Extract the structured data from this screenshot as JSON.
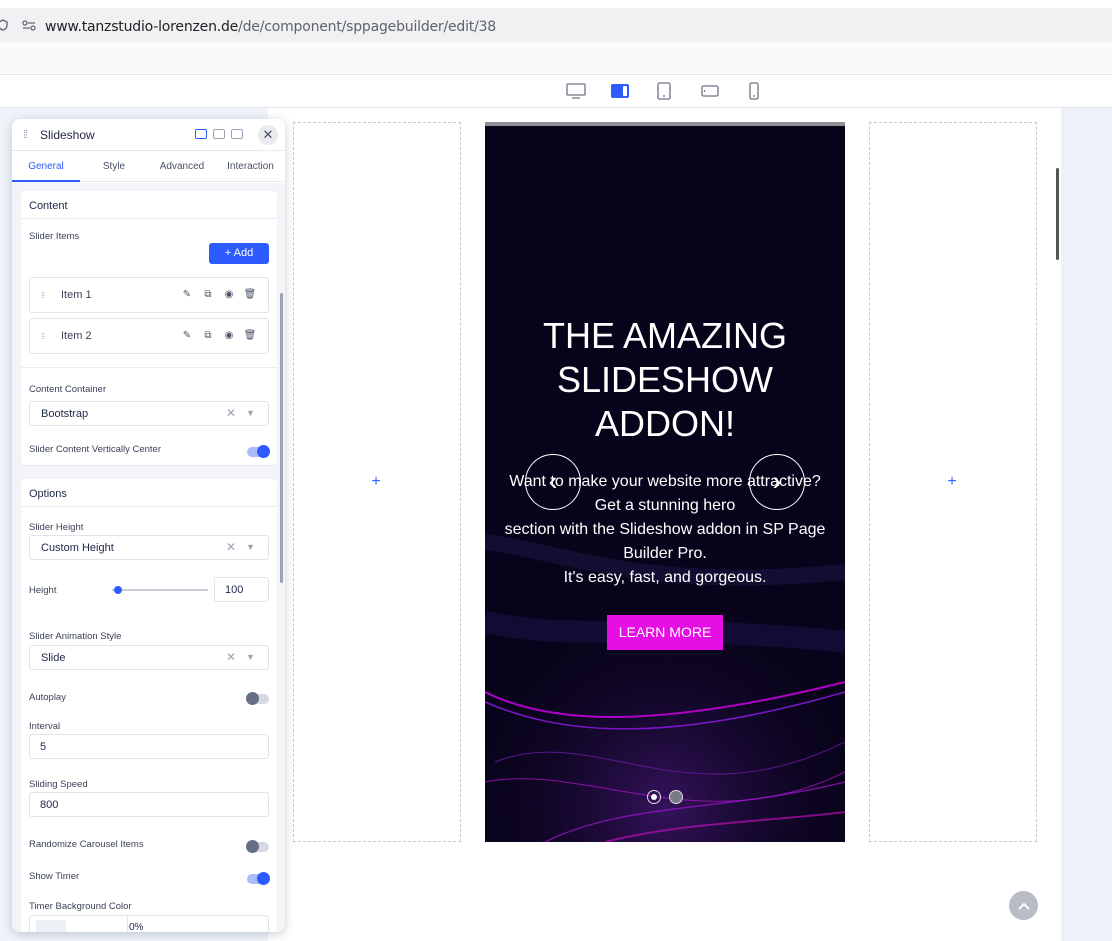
{
  "browser": {
    "url_domain": "www.tanzstudio-lorenzen.de",
    "url_path": "/de/component/sppagebuilder/edit/38"
  },
  "devices": [
    "desktop-icon",
    "laptop-icon",
    "tablet-icon",
    "tablet-landscape-icon",
    "mobile-icon"
  ],
  "panel": {
    "title": "Slideshow",
    "tabs": [
      "General",
      "Style",
      "Advanced",
      "Interaction"
    ],
    "content": {
      "section_title": "Content",
      "slider_items_label": "Slider Items",
      "add_label": "+ Add",
      "items": [
        "Item 1",
        "Item 2"
      ],
      "content_container_label": "Content Container",
      "content_container_value": "Bootstrap",
      "vertically_center_label": "Slider Content Vertically Center",
      "vertically_center_on": true
    },
    "options": {
      "section_title": "Options",
      "slider_height_label": "Slider Height",
      "slider_height_value": "Custom Height",
      "height_label": "Height",
      "height_value": "100",
      "height_slider_fraction": 0.05,
      "animation_label": "Slider Animation Style",
      "animation_value": "Slide",
      "autoplay_label": "Autoplay",
      "autoplay_on": false,
      "interval_label": "Interval",
      "interval_value": "5",
      "speed_label": "Sliding Speed",
      "speed_value": "800",
      "randomize_label": "Randomize Carousel Items",
      "randomize_on": false,
      "show_timer_label": "Show Timer",
      "show_timer_on": true,
      "timer_bg_label": "Timer Background Color",
      "timer_bg_value": "0%"
    }
  },
  "slide": {
    "title_line1": "THE AMAZING",
    "title_line2": "SLIDESHOW",
    "title_line3": "ADDON!",
    "sub_line1": "Want to make your website more attractive?",
    "sub_line2": "Get a stunning hero",
    "sub_line3": "section with the Slideshow addon in SP Page",
    "sub_line4": "Builder Pro.",
    "sub_line5": "It's easy, fast, and gorgeous.",
    "button_label": "LEARN MORE",
    "active_dot": 0,
    "dot_count": 2
  },
  "colors": {
    "accent": "#2e5bff",
    "slide_bg": "#08031a",
    "button_bg": "#e50fe5"
  }
}
